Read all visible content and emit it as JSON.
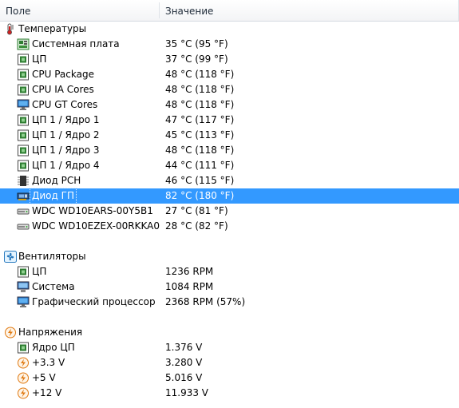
{
  "columns": {
    "field": "Поле",
    "value": "Значение"
  },
  "groups": [
    {
      "label": "Температуры",
      "icon": "thermometer-icon",
      "items": [
        {
          "label": "Системная плата",
          "value": "35 °C  (95 °F)",
          "icon": "motherboard-icon"
        },
        {
          "label": "ЦП",
          "value": "37 °C  (99 °F)",
          "icon": "cpu-chip-icon"
        },
        {
          "label": "CPU Package",
          "value": "48 °C  (118 °F)",
          "icon": "cpu-chip-icon"
        },
        {
          "label": "CPU IA Cores",
          "value": "48 °C  (118 °F)",
          "icon": "cpu-chip-icon"
        },
        {
          "label": "CPU GT Cores",
          "value": "48 °C  (118 °F)",
          "icon": "monitor-icon"
        },
        {
          "label": "ЦП 1 / Ядро 1",
          "value": "47 °C  (117 °F)",
          "icon": "cpu-chip-icon"
        },
        {
          "label": "ЦП 1 / Ядро 2",
          "value": "45 °C  (113 °F)",
          "icon": "cpu-chip-icon"
        },
        {
          "label": "ЦП 1 / Ядро 3",
          "value": "48 °C  (118 °F)",
          "icon": "cpu-chip-icon"
        },
        {
          "label": "ЦП 1 / Ядро 4",
          "value": "44 °C  (111 °F)",
          "icon": "cpu-chip-icon"
        },
        {
          "label": "Диод PCH",
          "value": "46 °C  (115 °F)",
          "icon": "chip-icon"
        },
        {
          "label": "Диод ГП",
          "value": "82 °C  (180 °F)",
          "icon": "graphics-card-icon",
          "selected": true
        },
        {
          "label": "WDC WD10EARS-00Y5B1",
          "value": "27 °C  (81 °F)",
          "icon": "hard-drive-icon"
        },
        {
          "label": "WDC WD10EZEX-00RKKA0",
          "value": "28 °C  (82 °F)",
          "icon": "hard-drive-icon"
        }
      ]
    },
    {
      "label": "Вентиляторы",
      "icon": "fan-icon",
      "items": [
        {
          "label": "ЦП",
          "value": "1236 RPM",
          "icon": "cpu-chip-icon"
        },
        {
          "label": "Система",
          "value": "1084 RPM",
          "icon": "computer-icon"
        },
        {
          "label": "Графический процессор",
          "value": "2368 RPM  (57%)",
          "icon": "monitor-icon"
        }
      ]
    },
    {
      "label": "Напряжения",
      "icon": "voltage-icon",
      "items": [
        {
          "label": "Ядро ЦП",
          "value": "1.376 V",
          "icon": "cpu-chip-icon"
        },
        {
          "label": "+3.3 V",
          "value": "3.280 V",
          "icon": "voltage-icon"
        },
        {
          "label": "+5 V",
          "value": "5.016 V",
          "icon": "voltage-icon"
        },
        {
          "label": "+12 V",
          "value": "11.933 V",
          "icon": "voltage-icon"
        }
      ]
    }
  ],
  "colors": {
    "selection": "#3399ff",
    "chip": "#2e7d32",
    "monitor": "#1f6fc2",
    "voltage": "#e07a12"
  }
}
